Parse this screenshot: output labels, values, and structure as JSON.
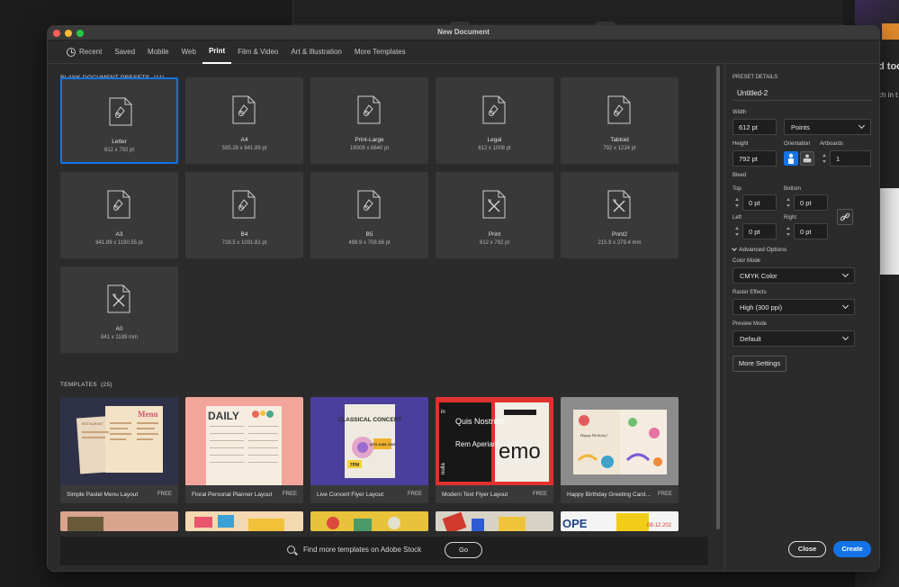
{
  "background": {
    "right_text_1": "d too",
    "right_text_2": "ch in t"
  },
  "window": {
    "title": "New Document"
  },
  "tabs": [
    {
      "label": "Recent",
      "icon": "clock-icon"
    },
    {
      "label": "Saved"
    },
    {
      "label": "Mobile"
    },
    {
      "label": "Web"
    },
    {
      "label": "Print",
      "active": true
    },
    {
      "label": "Film & Video"
    },
    {
      "label": "Art & Illustration"
    },
    {
      "label": "More Templates"
    }
  ],
  "presets": {
    "heading": "BLANK DOCUMENT PRESETS",
    "count": "(11)",
    "items": [
      {
        "name": "Letter",
        "size": "612 x 792 pt",
        "icon": "document-brush-icon",
        "selected": true
      },
      {
        "name": "A4",
        "size": "595.28 x 841.89 pt",
        "icon": "document-brush-icon"
      },
      {
        "name": "Print-Large",
        "size": "19008 x 8640 pt",
        "icon": "document-brush-icon"
      },
      {
        "name": "Legal",
        "size": "612 x 1008 pt",
        "icon": "document-brush-icon"
      },
      {
        "name": "Tabloid",
        "size": "792 x 1224 pt",
        "icon": "document-brush-icon"
      },
      {
        "name": "A3",
        "size": "841.89 x 1190.55 pt",
        "icon": "document-brush-icon"
      },
      {
        "name": "B4",
        "size": "728.5 x 1031.81 pt",
        "icon": "document-brush-icon"
      },
      {
        "name": "B5",
        "size": "498.9 x 708.66 pt",
        "icon": "document-brush-icon"
      },
      {
        "name": "Print",
        "size": "612 x 792 pt",
        "icon": "document-tools-icon"
      },
      {
        "name": "Print2",
        "size": "215.9 x 279.4 mm",
        "icon": "document-tools-icon"
      },
      {
        "name": "A0",
        "size": "841 x 1189 mm",
        "icon": "document-tools-icon"
      }
    ]
  },
  "templates": {
    "heading": "TEMPLATES",
    "count": "(25)",
    "free_label": "FREE",
    "items": [
      {
        "name": "Simple Pastel Menu Layout",
        "thumb_title": "Menu",
        "thumb_sub": "RESTAURANT"
      },
      {
        "name": "Floral Personal Planner Layout",
        "thumb_title": "DAILY"
      },
      {
        "name": "Live Concert Flyer Layout",
        "thumb_title": "CLASSICAL CONCERT",
        "thumb_sub": "13TH JUNE 20XX",
        "thumb_time": "7PM"
      },
      {
        "name": "Modern Text Flyer Layout",
        "thumb_title": "Quis Nostrum",
        "thumb_sub": "Rem Aperiam",
        "thumb_side": "in",
        "thumb_side2": "nulla",
        "thumb_big": "emo"
      },
      {
        "name": "Happy Birthday Greeting Card La...",
        "thumb_title": "Happy Birthday!"
      }
    ],
    "partial_row": [
      {
        "thumb_text": ""
      },
      {
        "thumb_text": ""
      },
      {
        "thumb_text": ""
      },
      {
        "thumb_text": ""
      },
      {
        "thumb_text": "OPE",
        "thumb_date": "08-12.202"
      }
    ]
  },
  "stock": {
    "text": "Find more templates on Adobe Stock",
    "go_label": "Go"
  },
  "preset_details": {
    "heading": "PRESET DETAILS",
    "doc_name": "Untitled-2",
    "width_label": "Width",
    "width_value": "612 pt",
    "units": "Points",
    "height_label": "Height",
    "height_value": "792 pt",
    "orientation_label": "Orientation",
    "artboards_label": "Artboards",
    "artboards_value": "1",
    "bleed_label": "Bleed",
    "top_label": "Top",
    "top_value": "0 pt",
    "bottom_label": "Bottom",
    "bottom_value": "0 pt",
    "left_label": "Left",
    "left_value": "0 pt",
    "right_label": "Right",
    "right_value": "0 pt",
    "advanced_label": "Advanced Options",
    "color_mode_label": "Color Mode",
    "color_mode_value": "CMYK Color",
    "raster_label": "Raster Effects",
    "raster_value": "High (300 ppi)",
    "preview_label": "Preview Mode",
    "preview_value": "Default",
    "more_settings": "More Settings",
    "close_label": "Close",
    "create_label": "Create"
  },
  "colors": {
    "accent": "#1473e6",
    "dialog_bg": "#2b2b2b",
    "tile_bg": "#393939"
  }
}
